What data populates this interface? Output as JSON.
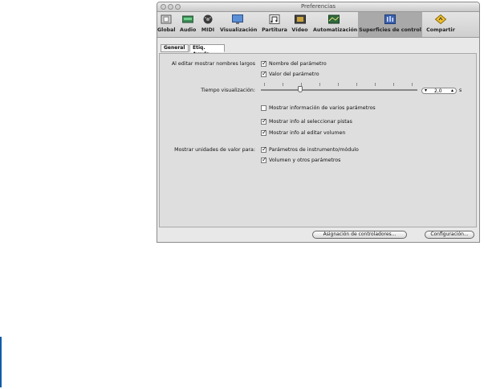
{
  "window": {
    "title": "Preferencias"
  },
  "toolbar": {
    "items": [
      {
        "label": "Global",
        "icon": "global-icon"
      },
      {
        "label": "Audio",
        "icon": "audio-icon"
      },
      {
        "label": "MIDI",
        "icon": "midi-icon"
      },
      {
        "label": "Visualización",
        "icon": "visualization-icon"
      },
      {
        "label": "Partitura",
        "icon": "score-icon"
      },
      {
        "label": "Vídeo",
        "icon": "video-icon"
      },
      {
        "label": "Automatización",
        "icon": "automation-icon"
      },
      {
        "label": "Superficies de control",
        "icon": "control-surfaces-icon",
        "selected": true
      },
      {
        "label": "Compartir",
        "icon": "share-icon"
      }
    ]
  },
  "tabs": [
    {
      "label": "General"
    },
    {
      "label": "Etiq. Ayuda",
      "selected": true
    }
  ],
  "settings": {
    "show_long_names_label": "Al editar mostrar nombres largos",
    "param_name_label": "Nombre del parámetro",
    "param_value_label": "Valor del parámetro",
    "display_time_label": "Tiempo visualización:",
    "display_time_value": "2,0",
    "display_time_unit": "s",
    "display_time_slider_fraction": 0.25,
    "show_multi_params_label": "Mostrar información de varios parámetros",
    "show_track_select_label": "Mostrar info al seleccionar pistas",
    "show_volume_edit_label": "Mostrar info al editar volumen",
    "show_value_units_label": "Mostrar unidades de valor para:",
    "instrument_params_label": "Parámetros de instrumento/módulo",
    "volume_params_label": "Volumen y otros parámetros"
  },
  "checkboxes": {
    "param_name": true,
    "param_value": true,
    "multi_params": false,
    "track_select": true,
    "volume_edit": true,
    "instrument_params": true,
    "volume_params": true
  },
  "buttons": {
    "controller_assignments": "Asignación de controladores...",
    "setup": "Configuración..."
  },
  "colors": {
    "selected_toolbar": "#a9a9a9",
    "accent_bar": "#0f5aa8"
  }
}
